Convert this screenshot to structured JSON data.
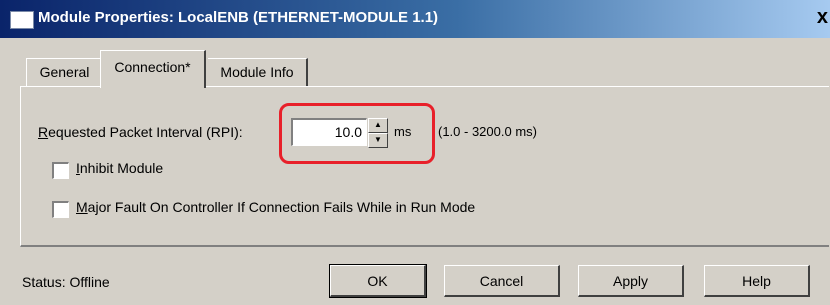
{
  "window": {
    "title": "Module Properties: LocalENB (ETHERNET-MODULE 1.1)",
    "close_glyph": "x"
  },
  "tabs": [
    {
      "label": "General"
    },
    {
      "label": "Connection*"
    },
    {
      "label": "Module Info"
    }
  ],
  "connection": {
    "rpi_label": "Requested Packet Interval (RPI):",
    "rpi_value": "10.0",
    "rpi_unit": "ms",
    "rpi_range": "(1.0 - 3200.0 ms)",
    "inhibit_label": "Inhibit Module",
    "inhibit_checked": false,
    "major_fault_label": "Major Fault On Controller If Connection Fails While in Run Mode",
    "major_fault_checked": false
  },
  "status": {
    "text": "Status:  Offline"
  },
  "buttons": {
    "ok": "OK",
    "cancel": "Cancel",
    "apply": "Apply",
    "help": "Help"
  },
  "colors": {
    "title_bar_start": "#0a246a",
    "title_bar_end": "#a6caf0",
    "highlight": "#e8202a",
    "face": "#d4d0c8"
  }
}
